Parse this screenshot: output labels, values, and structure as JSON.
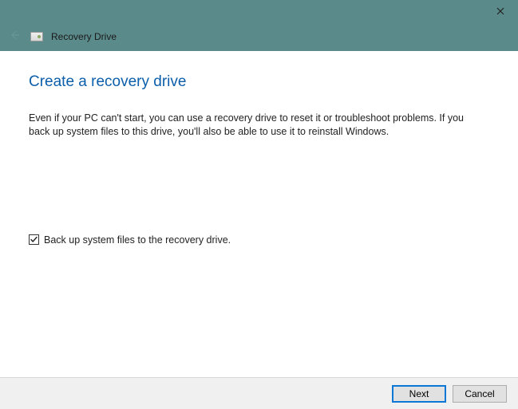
{
  "window": {
    "title": "Recovery Drive"
  },
  "page": {
    "heading": "Create a recovery drive",
    "description": "Even if your PC can't start, you can use a recovery drive to reset it or troubleshoot problems. If you back up system files to this drive, you'll also be able to use it to reinstall Windows."
  },
  "checkbox": {
    "label": "Back up system files to the recovery drive.",
    "checked": true
  },
  "buttons": {
    "next": "Next",
    "cancel": "Cancel"
  }
}
